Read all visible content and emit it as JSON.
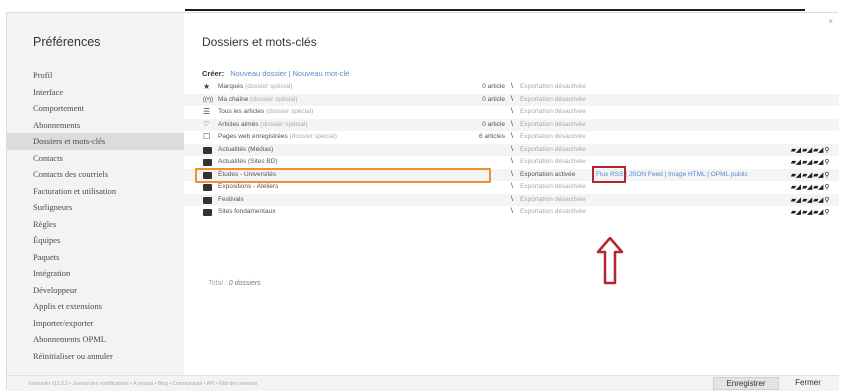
{
  "sidebar": {
    "title": "Préférences",
    "items": [
      {
        "label": "Profil"
      },
      {
        "label": "Interface"
      },
      {
        "label": "Comportement"
      },
      {
        "label": "Abonnements"
      },
      {
        "label": "Dossiers et mots-clés",
        "active": true
      },
      {
        "label": "Contacts"
      },
      {
        "label": "Contacts des courriels"
      },
      {
        "label": "Facturation et utilisation"
      },
      {
        "label": "Surligneurs"
      },
      {
        "label": "Règles"
      },
      {
        "label": "Équipes"
      },
      {
        "label": "Paquets"
      },
      {
        "label": "Intégration"
      },
      {
        "label": "Développeur"
      },
      {
        "label": "Applis et extensions"
      },
      {
        "label": "Importer/exporter"
      },
      {
        "label": "Abonnements OPML"
      },
      {
        "label": "Réinitialiser ou annuler"
      }
    ]
  },
  "main": {
    "title": "Dossiers et mots-clés",
    "close": "×",
    "create_label": "Créer:",
    "new_folder": "Nouveau dossier",
    "separator": "|",
    "new_tag": "Nouveau mot-clé",
    "rows": [
      {
        "icon": "star-icon",
        "glyph": "★",
        "name": "Marqués",
        "special": "(dossier spécial)",
        "count": "0 article",
        "export": "Exportation désactivée"
      },
      {
        "icon": "broadcast-icon",
        "glyph": "((•))",
        "name": "Ma chaîne",
        "special": "(dossier spécial)",
        "count": "0 article",
        "export": "Exportation désactivée"
      },
      {
        "icon": "list-icon",
        "glyph": "☰",
        "name": "Tous les articles",
        "special": "(dossier spécial)",
        "count": "",
        "export": "Exportation désactivée"
      },
      {
        "icon": "thumbs-up-icon",
        "glyph": "👍",
        "name": "Articles aimés",
        "special": "(dossier spécial)",
        "count": "0 article",
        "export": "Exportation désactivée"
      },
      {
        "icon": "bookmark-icon",
        "glyph": "☐",
        "name": "Pages web enregistrées",
        "special": "(dossier spécial)",
        "count": "6 articles",
        "export": "Exportation désactivée"
      },
      {
        "icon": "folder-icon",
        "name": "Actualités (Médias)",
        "special": "",
        "count": "",
        "export": "Exportation désactivée"
      },
      {
        "icon": "folder-icon",
        "name": "Actualités (Sites BD)",
        "special": "",
        "count": "",
        "export": "Exportation désactivée"
      },
      {
        "icon": "folder-icon",
        "name": "Études - Universités",
        "special": "",
        "count": "",
        "export": "Exportation activée"
      },
      {
        "icon": "folder-icon",
        "name": "Expositions - Ateliers",
        "special": "",
        "count": "",
        "export": "Exportation désactivée"
      },
      {
        "icon": "folder-icon",
        "name": "Festivals",
        "special": "",
        "count": "",
        "export": "Exportation désactivée"
      },
      {
        "icon": "folder-icon",
        "name": "Sites fondamentaux",
        "special": "",
        "count": "",
        "export": "Exportation désactivée"
      }
    ],
    "export_links": {
      "rss": "Flux RSS",
      "json": "JSON Feed",
      "html": "Image HTML",
      "opml": "OPML public",
      "separator": "|"
    },
    "tools_glyph": "▰◢ ▰◢ ▰◢ ⚲",
    "total_label": "Total :",
    "total_value": "0 dossiers"
  },
  "footer": {
    "text": "Inoreader v11.3.2 • Journal des modifications • À propos • Blog • Communauté • API • État des services",
    "save": "Enregistrer",
    "close": "Fermer"
  },
  "colors": {
    "highlight_orange": "#f0922c",
    "highlight_red": "#b5262c",
    "link": "#5a8ac9"
  }
}
